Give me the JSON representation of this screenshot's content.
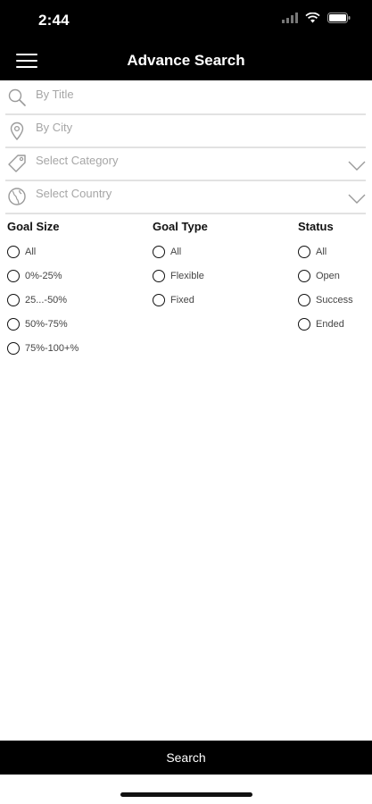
{
  "status_bar": {
    "time": "2:44"
  },
  "header": {
    "title": "Advance Search"
  },
  "fields": {
    "title": {
      "placeholder": "By Title",
      "icon": "search-icon"
    },
    "city": {
      "placeholder": "By City",
      "icon": "location-pin-icon"
    },
    "category": {
      "placeholder": "Select Category",
      "icon": "tag-icon"
    },
    "country": {
      "placeholder": "Select Country",
      "icon": "globe-icon"
    }
  },
  "filters": {
    "goal_size": {
      "title": "Goal Size",
      "options": [
        "All",
        "0%-25%",
        "25...-50%",
        "50%-75%",
        "75%-100+%"
      ]
    },
    "goal_type": {
      "title": "Goal Type",
      "options": [
        "All",
        "Flexible",
        "Fixed"
      ]
    },
    "status": {
      "title": "Status",
      "options": [
        "All",
        "Open",
        "Success",
        "Ended"
      ]
    }
  },
  "search_button": {
    "label": "Search"
  }
}
